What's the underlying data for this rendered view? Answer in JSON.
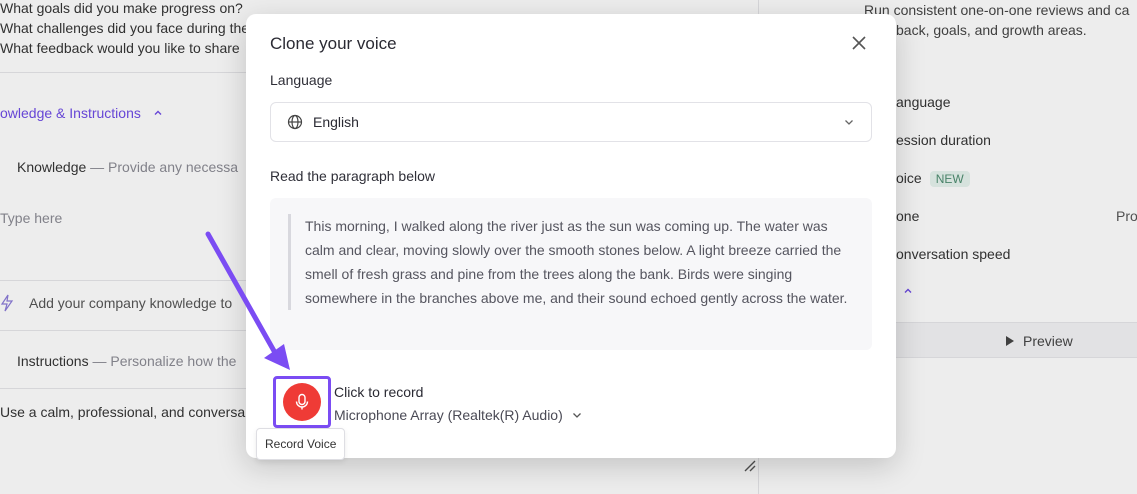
{
  "background": {
    "questions": [
      "What goals did you make progress on?",
      "What challenges did you face during the",
      "What feedback would you like to share"
    ],
    "knowledge_section_link": "owledge & Instructions",
    "knowledge_label": "Knowledge",
    "knowledge_desc": " — Provide any necessa",
    "type_here_placeholder": "Type here",
    "add_knowledge_text": "Add your company knowledge to",
    "instructions_label": "Instructions",
    "instructions_desc": " — Personalize how the",
    "instructions_value": "Use a calm, professional, and conversa",
    "right_desc_line1": "Run consistent one-on-one reviews and ca",
    "right_desc_line2": "back, goals, and growth areas.",
    "settings": [
      {
        "label": "anguage"
      },
      {
        "label": "ession duration"
      },
      {
        "label": "oice",
        "badge": "NEW"
      },
      {
        "label": "one",
        "value": "Pro"
      },
      {
        "label": "onversation speed"
      }
    ],
    "preview_label": "Preview"
  },
  "modal": {
    "title": "Clone your voice",
    "language_label": "Language",
    "language_value": "English",
    "paragraph_label": "Read the paragraph below",
    "paragraph": "This morning, I walked along the river just as the sun was coming up. The water was calm and clear, moving slowly over the smooth stones below. A light breeze carried the smell of fresh grass and pine from the trees along the bank. Birds were singing somewhere in the branches above me, and their sound echoed gently across the water.",
    "record_title": "Click to record",
    "microphone_value": "Microphone Array (Realtek(R) Audio)",
    "record_tooltip": "Record Voice"
  },
  "colors": {
    "accent": "#7b4cf3",
    "record": "#ef3b36"
  }
}
